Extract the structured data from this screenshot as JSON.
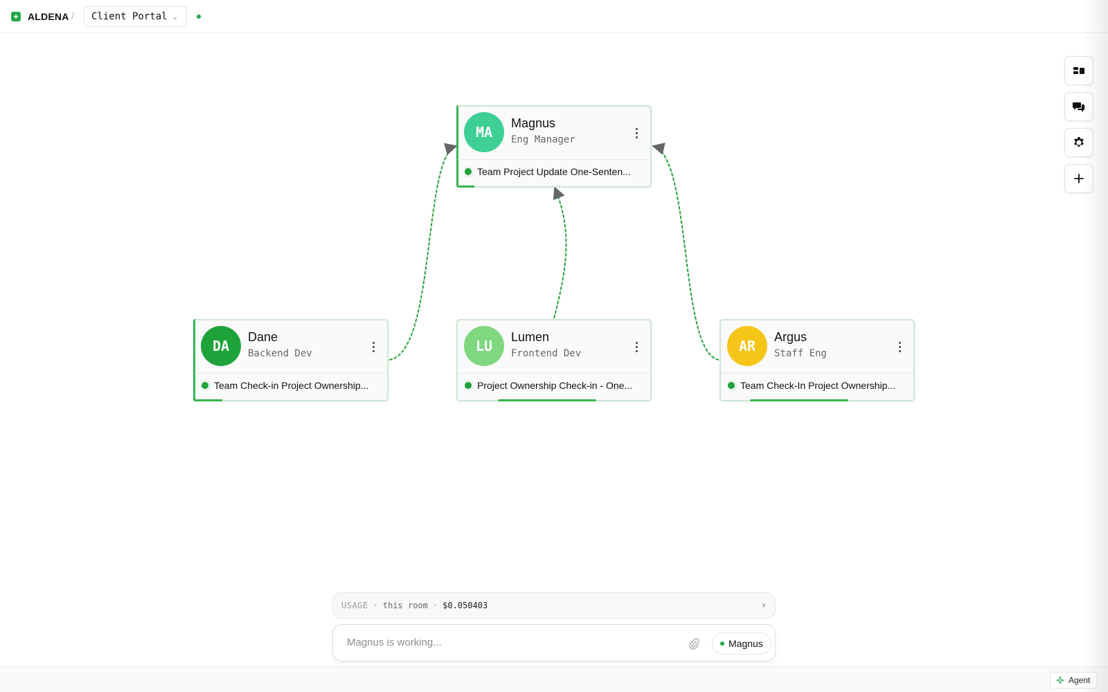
{
  "header": {
    "brand": "ALDENA",
    "separator": "/",
    "project": "Client Portal",
    "status": "live"
  },
  "toolbar": {
    "items": [
      {
        "name": "layout",
        "icon": "layout-icon"
      },
      {
        "name": "chat",
        "icon": "chat-icon"
      },
      {
        "name": "settings",
        "icon": "gear-icon"
      },
      {
        "name": "add",
        "icon": "plus-icon"
      }
    ]
  },
  "nodes": {
    "magnus": {
      "initials": "MA",
      "name": "Magnus",
      "role": "Eng Manager",
      "task": "Team Project Update One-Senten...",
      "color": "#3ecf94"
    },
    "dane": {
      "initials": "DA",
      "name": "Dane",
      "role": "Backend Dev",
      "task": "Team Check-in Project Ownership...",
      "color": "#1ea33a"
    },
    "lumen": {
      "initials": "LU",
      "name": "Lumen",
      "role": "Frontend Dev",
      "task": "Project Ownership Check-in - One...",
      "color": "#7fd77f"
    },
    "argus": {
      "initials": "AR",
      "name": "Argus",
      "role": "Staff Eng",
      "task": "Team Check-In Project Ownership...",
      "color": "#f5c518"
    }
  },
  "usage": {
    "label": "USAGE",
    "sep": "·",
    "scope": "this room",
    "cost": "$0.050403",
    "arrow": "›"
  },
  "composer": {
    "placeholder": "Magnus is working...",
    "agent": "Magnus"
  },
  "footer": {
    "agent_label": "Agent"
  },
  "colors": {
    "accent": "#22a849",
    "edge": "#2aa13f"
  }
}
